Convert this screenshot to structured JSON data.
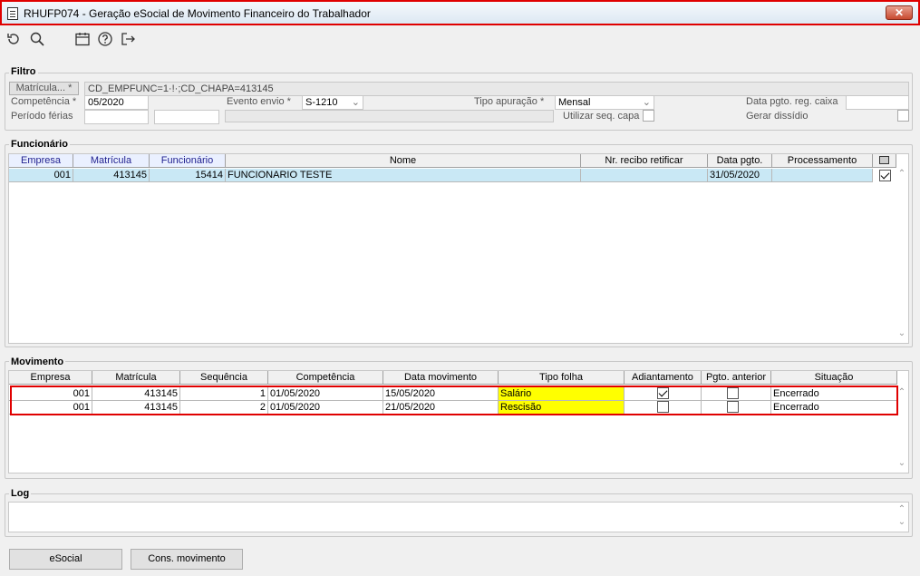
{
  "window": {
    "title": "RHUFP074 - Geração eSocial de Movimento Financeiro do Trabalhador",
    "close_glyph": "✕"
  },
  "toolbar": {
    "icons": [
      "refresh-icon",
      "search-icon",
      "calendar-icon",
      "help-icon",
      "exit-icon"
    ]
  },
  "filtro": {
    "label": "Filtro",
    "matricula_button": "Matrícula... *",
    "matricula_value": "CD_EMPFUNC=1·!·;CD_CHAPA=413145",
    "competencia_label": "Competência *",
    "competencia_value": "05/2020",
    "evento_label": "Evento envio *",
    "evento_value": "S-1210",
    "tipo_apuracao_label": "Tipo apuração *",
    "tipo_apuracao_value": "Mensal",
    "data_pgto_label": "Data pgto. reg. caixa",
    "periodo_ferias_label": "Período férias",
    "utilizar_seq_label": "Utilizar seq. capa",
    "gerar_dissidio_label": "Gerar dissídio"
  },
  "funcionario": {
    "label": "Funcionário",
    "columns": [
      "Empresa",
      "Matrícula",
      "Funcionário",
      "Nome",
      "Nr. recibo retificar",
      "Data pgto.",
      "Processamento"
    ],
    "rows": [
      {
        "empresa": "001",
        "matricula": "413145",
        "funcionario": "15414",
        "nome": "FUNCIONARIO TESTE",
        "recibo": "",
        "data_pgto": "31/05/2020",
        "processamento": "",
        "checked": true
      }
    ]
  },
  "movimento": {
    "label": "Movimento",
    "columns": [
      "Empresa",
      "Matrícula",
      "Sequência",
      "Competência",
      "Data movimento",
      "Tipo folha",
      "Adiantamento",
      "Pgto. anterior",
      "Situação"
    ],
    "rows": [
      {
        "empresa": "001",
        "matricula": "413145",
        "sequencia": "1",
        "competencia": "01/05/2020",
        "data_movimento": "15/05/2020",
        "tipo_folha": "Salário",
        "adiantamento": true,
        "pgto_anterior": false,
        "situacao": "Encerrado"
      },
      {
        "empresa": "001",
        "matricula": "413145",
        "sequencia": "2",
        "competencia": "01/05/2020",
        "data_movimento": "21/05/2020",
        "tipo_folha": "Rescisão",
        "adiantamento": false,
        "pgto_anterior": false,
        "situacao": "Encerrado"
      }
    ]
  },
  "log": {
    "label": "Log"
  },
  "buttons": {
    "esocial": "eSocial",
    "cons_movimento": "Cons. movimento"
  },
  "colors": {
    "highlight_border": "#e00000",
    "selected_row": "#c9e8f5",
    "tipo_folha_bg": "#ffff00"
  }
}
